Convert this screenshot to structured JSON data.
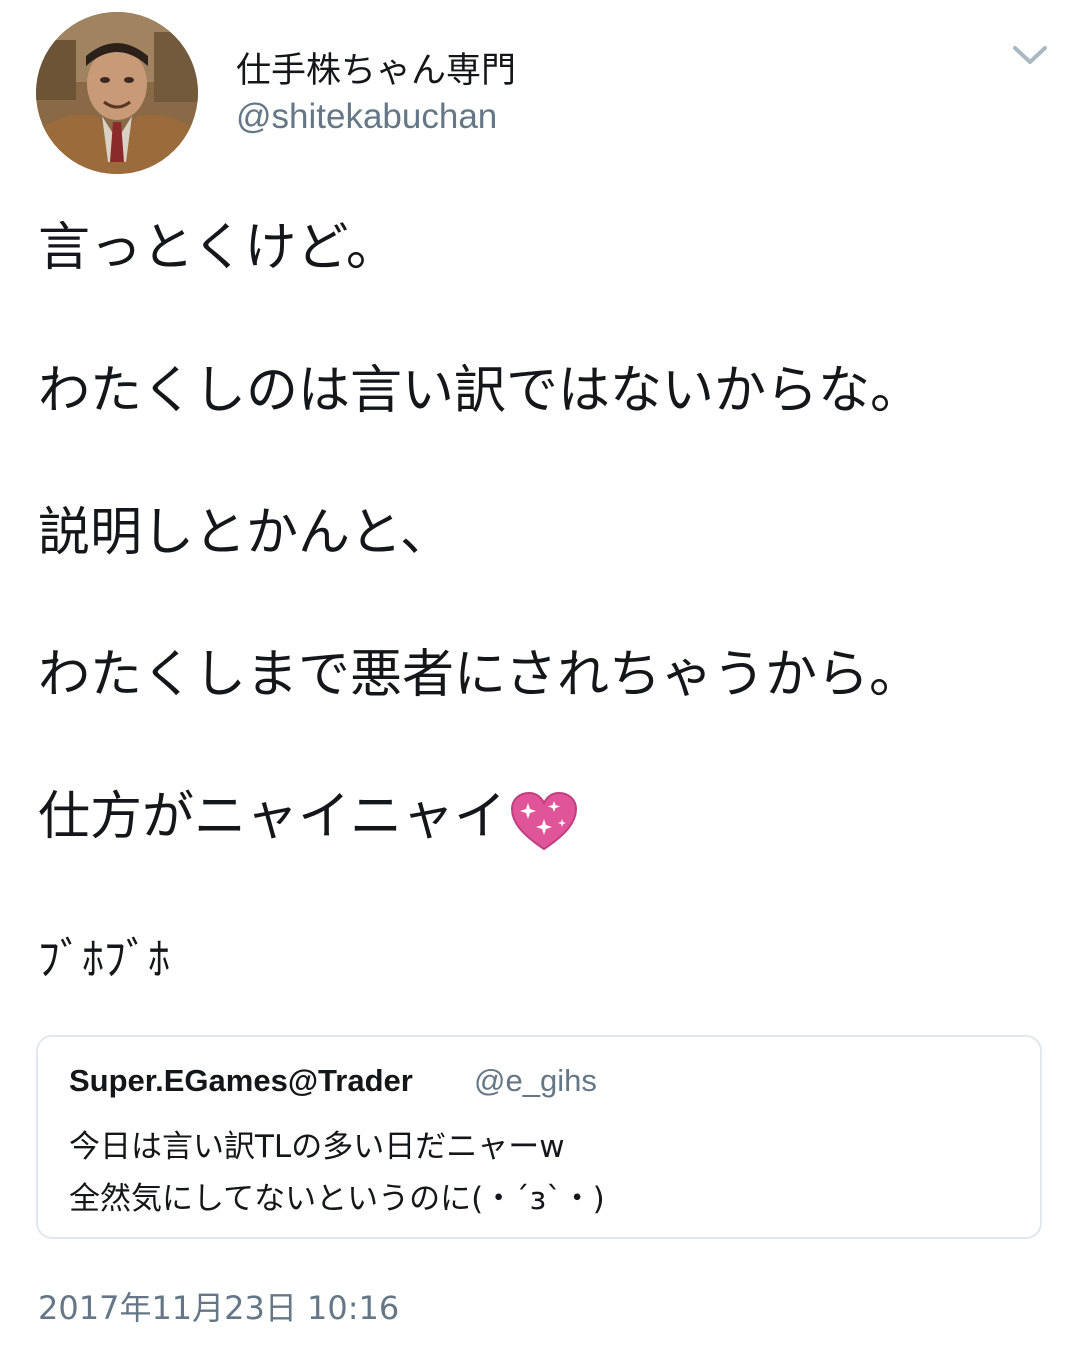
{
  "author": {
    "display_name": "仕手株ちゃん専門",
    "handle": "@shitekabuchan",
    "avatar_icon": "profile-photo"
  },
  "menu": {
    "icon": "chevron-down-icon"
  },
  "tweet": {
    "lines": [
      "言っとくけど。",
      "わたくしのは言い訳ではないからな。",
      "説明しとかんと、",
      "わたくしまで悪者にされちゃうから。",
      "仕方がニャイニャイ",
      "ﾌﾞﾎﾌﾞﾎ"
    ],
    "emoji": "sparkling-heart-icon"
  },
  "quoted_tweet": {
    "name": "Super.EGames@Trader",
    "handle": "@e_gihs",
    "lines": [
      "今日は言い訳TLの多い日だニャーw",
      "全然気にしてないというのに(・´з`・)"
    ]
  },
  "timestamp": "2017年11月23日 10:16",
  "colors": {
    "text": "#14171a",
    "secondary_text": "#657786",
    "border": "#e1e8ed",
    "heart": "#e0559a"
  }
}
